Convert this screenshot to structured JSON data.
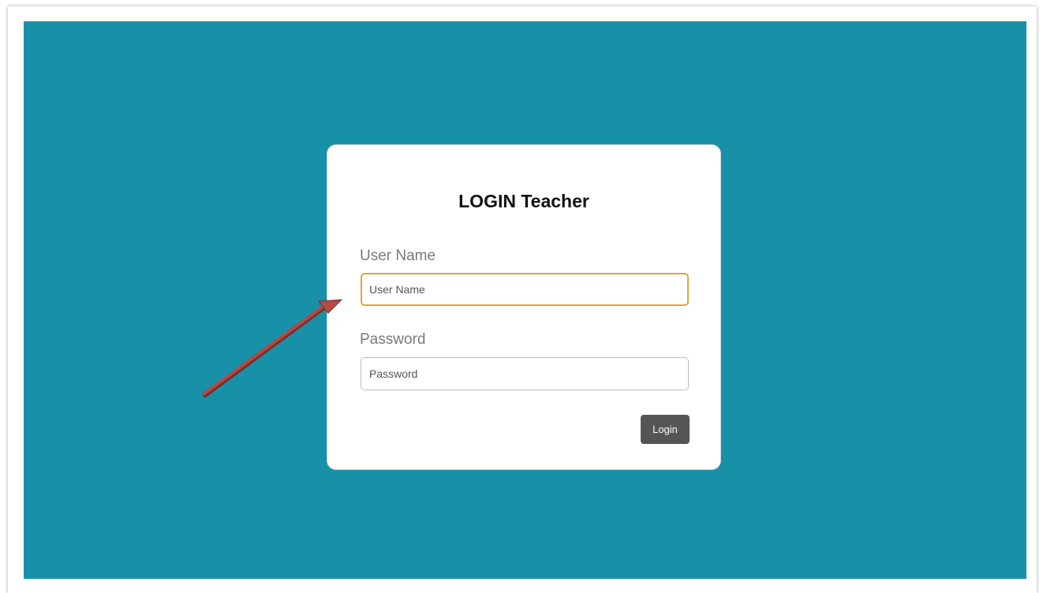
{
  "login": {
    "title": "LOGIN Teacher",
    "username_label": "User Name",
    "username_placeholder": "User Name",
    "username_value": "",
    "password_label": "Password",
    "password_placeholder": "Password",
    "password_value": "",
    "submit_label": "Login"
  },
  "colors": {
    "background": "#1891a8",
    "card": "#ffffff",
    "focus_border": "#e0a63a",
    "button": "#555555",
    "annotation_arrow": "#b24a45"
  },
  "annotation": {
    "icon": "red-arrow-icon"
  }
}
